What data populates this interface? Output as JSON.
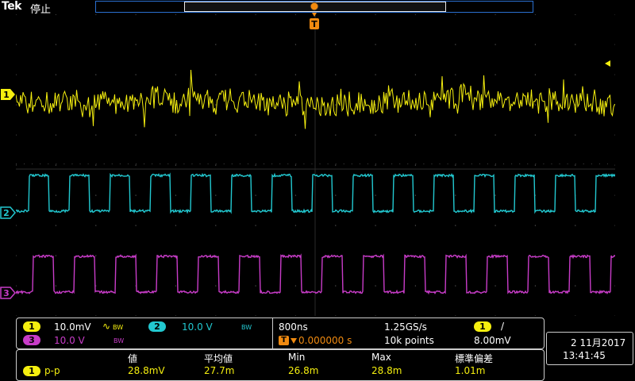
{
  "header": {
    "brand": "Tek",
    "status": "停止"
  },
  "markers": {
    "trigger_glyph": "T",
    "ch1": "1",
    "ch2": "2",
    "ch3": "3"
  },
  "channels": [
    {
      "id": "1",
      "scale": "10.0mV",
      "coupling_symbol": "∿",
      "bw_symbol": "BW",
      "color": "#f5ef0f"
    },
    {
      "id": "2",
      "scale": "10.0 V",
      "bw_symbol": "BW",
      "color": "#22c8d0"
    },
    {
      "id": "3",
      "scale": "10.0 V",
      "bw_symbol": "BW",
      "color": "#c83cc8"
    }
  ],
  "timebase": {
    "horizontal_scale": "800ns",
    "position": "0.000000 s",
    "sample_rate": "1.25GS/s",
    "record_length": "10k points",
    "trigger_source": "1",
    "trigger_slope": "/",
    "trigger_level": "8.00mV"
  },
  "measurements": {
    "headers": [
      "値",
      "平均値",
      "Min",
      "Max",
      "標準偏差"
    ],
    "rows": [
      {
        "channel": "1",
        "type": "p-p",
        "values": [
          "28.8mV",
          "27.7m",
          "26.8m",
          "28.8m",
          "1.01m"
        ]
      }
    ]
  },
  "datetime": {
    "date": "2 11月2017",
    "time": "13:41:45"
  }
}
